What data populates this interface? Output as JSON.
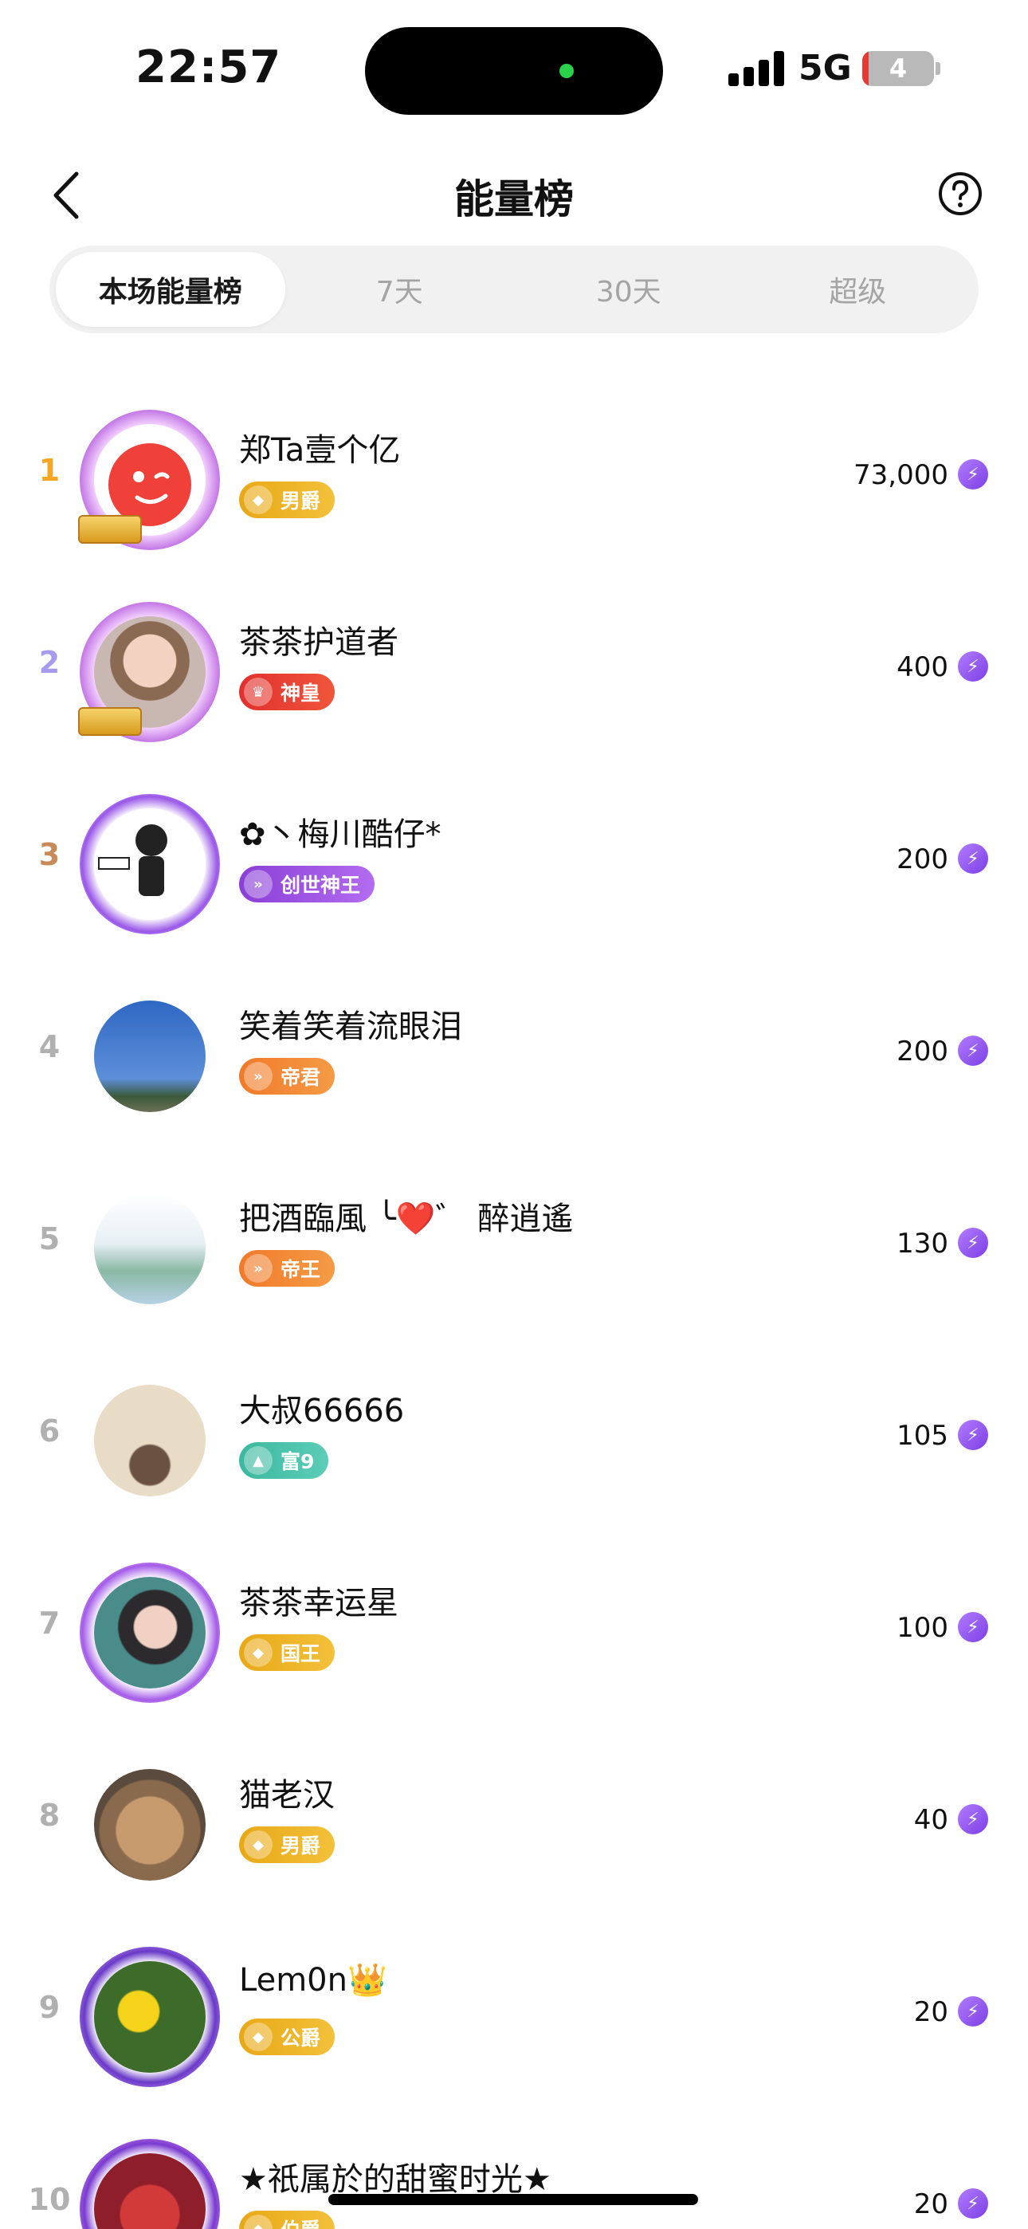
{
  "status_bar": {
    "time": "22:57",
    "network": "5G",
    "battery": "4"
  },
  "header": {
    "title": "能量榜"
  },
  "tabs": [
    {
      "label": "本场能量榜",
      "active": true
    },
    {
      "label": "7天",
      "active": false
    },
    {
      "label": "30天",
      "active": false
    },
    {
      "label": "超级",
      "active": false
    }
  ],
  "colors": {
    "rank1": "#f5a623",
    "rank2": "#a79bf0",
    "rank3": "#c88a58",
    "rank_other": "#b0b0b0",
    "bolt": "#8a4df0"
  },
  "ranking": [
    {
      "rank": "1",
      "name": "郑Ta壹个亿",
      "badge": "男爵",
      "badge_color": "#e8a816",
      "score": "73,000",
      "avatar": "red-smiley-avatar"
    },
    {
      "rank": "2",
      "name": "茶茶护道者",
      "badge": "神皇",
      "badge_color": "#e0302f",
      "score": "400",
      "avatar": "woman-portrait-avatar"
    },
    {
      "rank": "3",
      "name": "✿丶梅川酷仔*",
      "badge": "创世神王",
      "badge_color": "#8a3fd6",
      "score": "200",
      "avatar": "kuzai-cartoon-avatar"
    },
    {
      "rank": "4",
      "name": "笑着笑着流眼泪",
      "badge": "帝君",
      "badge_color": "#f07a2a",
      "score": "200",
      "avatar": "blue-sky-avatar"
    },
    {
      "rank": "5",
      "name": "把酒臨風 ╰❤️゛ 醉逍遙",
      "badge": "帝王",
      "badge_color": "#f07a2a",
      "score": "130",
      "avatar": "calligraphy-avatar"
    },
    {
      "rank": "6",
      "name": "大叔66666",
      "badge": "富9",
      "badge_color": "#3cb8a0",
      "score": "105",
      "avatar": "man-text-avatar"
    },
    {
      "rank": "7",
      "name": "茶茶幸运星",
      "badge": "国王",
      "badge_color": "#e8a816",
      "score": "100",
      "avatar": "woman-frame-avatar"
    },
    {
      "rank": "8",
      "name": "猫老汉",
      "badge": "男爵",
      "badge_color": "#e8a816",
      "score": "40",
      "avatar": "cat-avatar"
    },
    {
      "rank": "9",
      "name": "Lem0n👑",
      "badge": "公爵",
      "badge_color": "#e8a816",
      "score": "20",
      "avatar": "dandelion-avatar"
    },
    {
      "rank": "10",
      "name": "★祇属於的甜蜜时光★",
      "badge": "伯爵",
      "badge_color": "#e8a816",
      "score": "20",
      "avatar": "red-heart-avatar"
    }
  ]
}
